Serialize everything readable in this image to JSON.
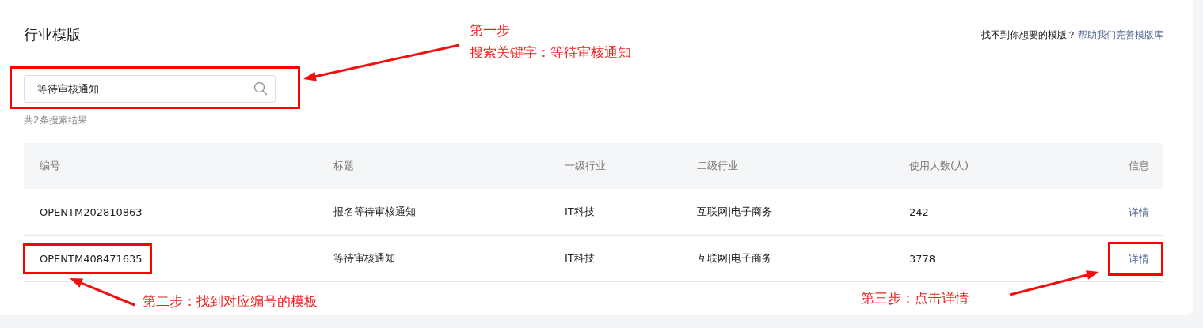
{
  "page": {
    "title": "行业模版",
    "help_prompt": "找不到你想要的模版？",
    "help_link": "帮助我们完善模版库"
  },
  "search": {
    "value": "等待审核通知",
    "highlighted": true
  },
  "result_count": "共2条搜索结果",
  "table": {
    "columns": [
      "编号",
      "标题",
      "一级行业",
      "二级行业",
      "使用人数(人)",
      "信息"
    ],
    "rows": [
      {
        "cells": [
          "OPENTM202810863",
          "报名等待审核通知",
          "IT科技",
          "互联网|电子商务",
          "242"
        ],
        "action": "详情",
        "highlighted": false
      },
      {
        "cells": [
          "OPENTM408471635",
          "等待审核通知",
          "IT科技",
          "互联网|电子商务",
          "3778"
        ],
        "action": "详情",
        "highlighted": true
      }
    ]
  },
  "annotations": [
    {
      "lines": [
        "第一步",
        "搜索关键字：等待审核通知"
      ]
    },
    {
      "lines": [
        "第二步：找到对应编号的模板"
      ]
    },
    {
      "lines": [
        "第三步：点击详情"
      ]
    }
  ]
}
